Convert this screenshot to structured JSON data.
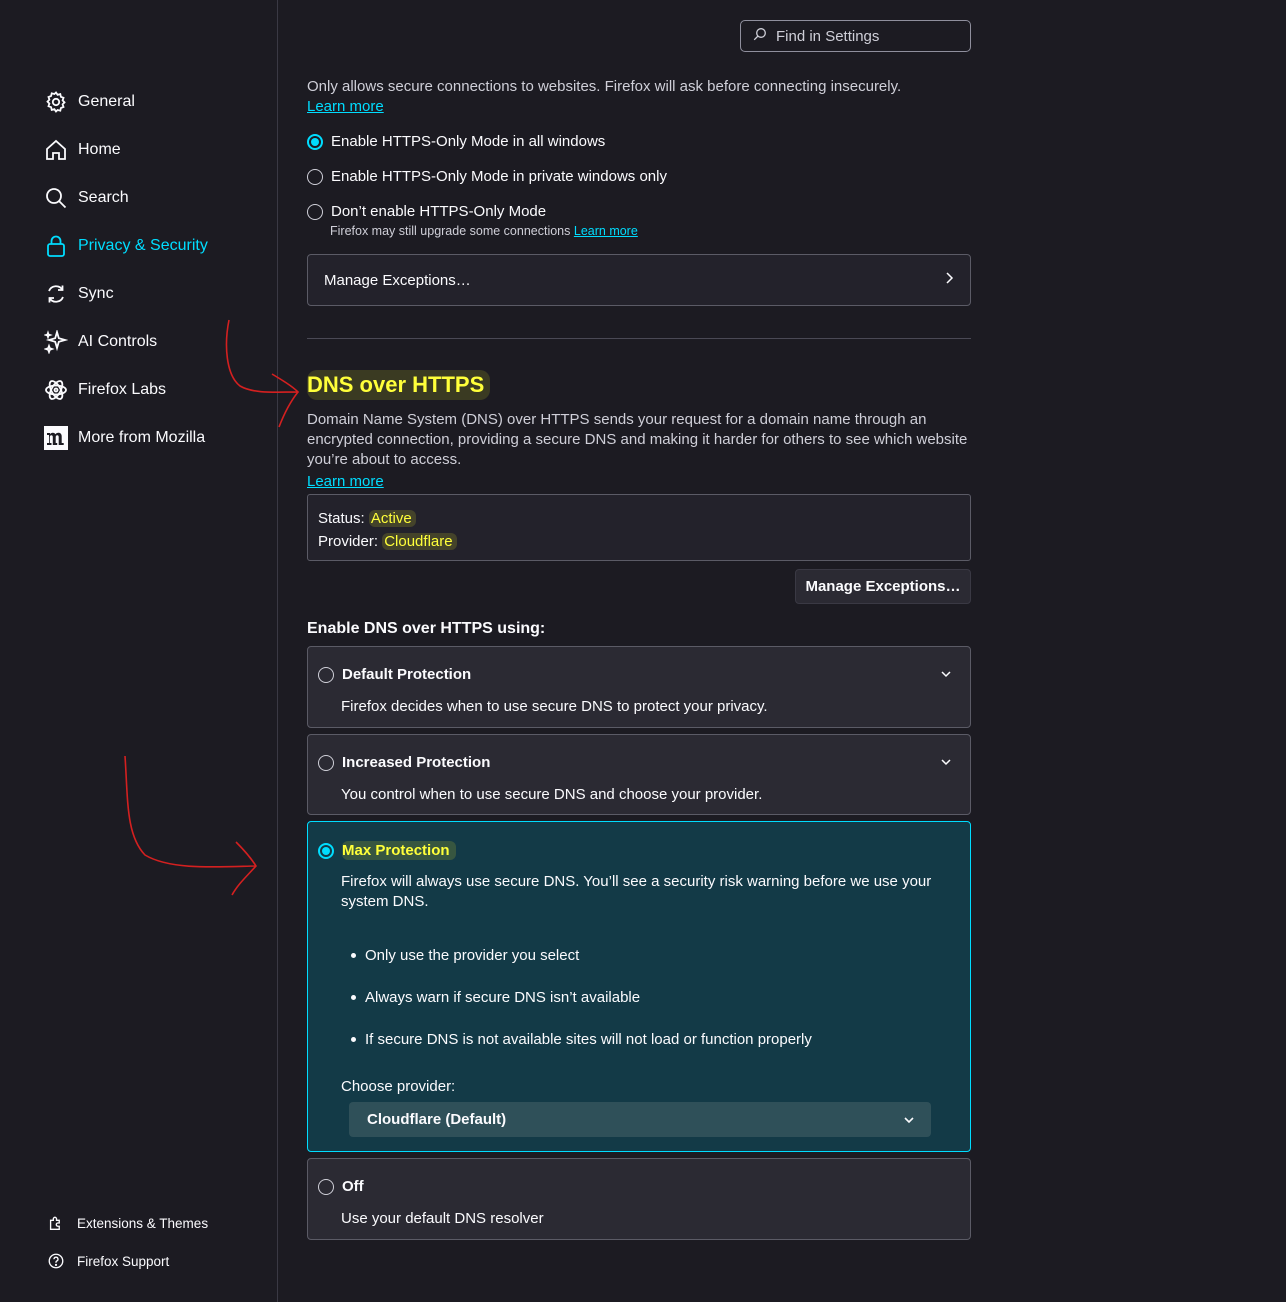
{
  "sidebar": {
    "items": [
      {
        "label": "General",
        "icon": "gear-icon"
      },
      {
        "label": "Home",
        "icon": "home-icon"
      },
      {
        "label": "Search",
        "icon": "search-icon"
      },
      {
        "label": "Privacy & Security",
        "icon": "lock-icon",
        "active": true
      },
      {
        "label": "Sync",
        "icon": "sync-icon"
      },
      {
        "label": "AI Controls",
        "icon": "sparkle-icon"
      },
      {
        "label": "Firefox Labs",
        "icon": "labs-icon"
      },
      {
        "label": "More from Mozilla",
        "icon": "mozilla-logo-icon"
      }
    ],
    "footer": [
      {
        "label": "Extensions & Themes",
        "icon": "puzzle-icon"
      },
      {
        "label": "Firefox Support",
        "icon": "help-icon"
      }
    ]
  },
  "search": {
    "placeholder": "Find in Settings"
  },
  "https_only": {
    "description": "Only allows secure connections to websites. Firefox will ask before connecting insecurely.",
    "learn_more": "Learn more",
    "options": [
      {
        "label": "Enable HTTPS-Only Mode in all windows",
        "checked": true
      },
      {
        "label": "Enable HTTPS-Only Mode in private windows only",
        "checked": false
      },
      {
        "label": "Don’t enable HTTPS-Only Mode",
        "checked": false
      }
    ],
    "dont_enable_note": "Firefox may still upgrade some connections",
    "note_learn_more": "Learn more",
    "manage_exceptions": "Manage Exceptions…"
  },
  "doh": {
    "heading": "DNS over HTTPS",
    "description": "Domain Name System (DNS) over HTTPS sends your request for a domain name through an encrypted connection, providing a secure DNS and making it harder for others to see which website you’re about to access.",
    "learn_more": "Learn more",
    "status_label": "Status:",
    "status_value": "Active",
    "provider_label": "Provider:",
    "provider_value": "Cloudflare",
    "manage_exceptions": "Manage Exceptions…",
    "enable_using": "Enable DNS over HTTPS using:",
    "modes": {
      "default": {
        "title": "Default Protection",
        "desc": "Firefox decides when to use secure DNS to protect your privacy."
      },
      "increased": {
        "title": "Increased Protection",
        "desc": "You control when to use secure DNS and choose your provider."
      },
      "max": {
        "title": "Max Protection",
        "desc": "Firefox will always use secure DNS. You’ll see a security risk warning before we use your system DNS.",
        "bullets": [
          "Only use the provider you select",
          "Always warn if secure DNS isn’t available",
          "If secure DNS is not available sites will not load or function properly"
        ],
        "choose_provider": "Choose provider:",
        "provider_selected": "Cloudflare (Default)"
      },
      "off": {
        "title": "Off",
        "desc": "Use your default DNS resolver"
      }
    }
  },
  "colors": {
    "accent": "#00ddff",
    "highlight": "#ffff3a",
    "annotation": "#d42020",
    "background": "#1c1b22"
  }
}
